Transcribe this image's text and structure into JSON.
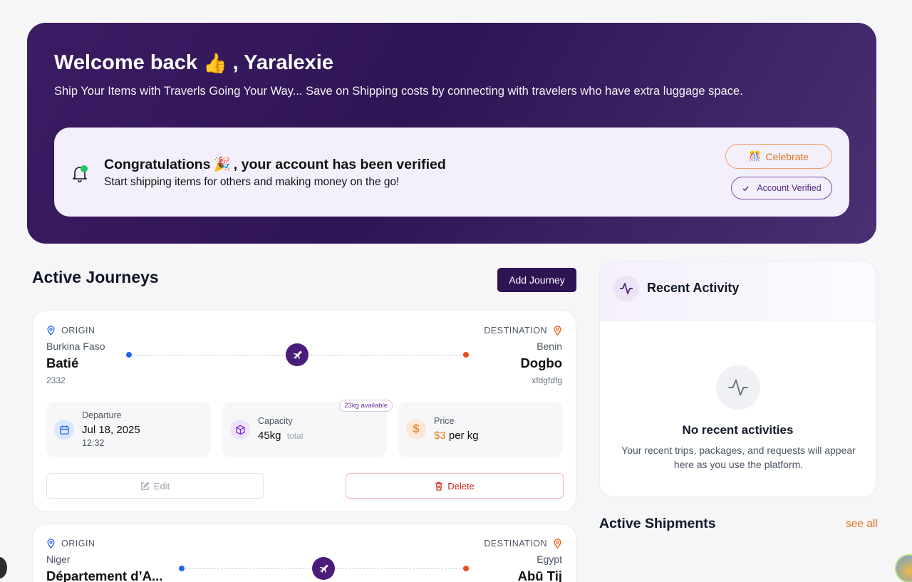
{
  "hero": {
    "title_prefix": "Welcome back",
    "title_emoji": "👍",
    "title_name": ", Yaralexie",
    "subtitle": "Ship Your Items with Traverls Going Your Way... Save on Shipping costs by connecting with travelers who have extra luggage space."
  },
  "verification": {
    "title_prefix": "Congratulations",
    "title_emoji": "🎉",
    "title_suffix": ", your account has been verified",
    "subtitle": "Start shipping items for others and making money on the go!",
    "celebrate_emoji": "🎊",
    "celebrate_label": "Celebrate",
    "verified_label": "Account Verified"
  },
  "journeys": {
    "title": "Active Journeys",
    "add_label": "Add Journey",
    "items": [
      {
        "origin_label": "ORIGIN",
        "origin_country": "Burkina Faso",
        "origin_city": "Batié",
        "origin_code": "2332",
        "destination_label": "DESTINATION",
        "destination_country": "Benin",
        "destination_city": "Dogbo",
        "destination_code": "xfdgfdfg",
        "departure_label": "Departure",
        "departure_date": "Jul 18, 2025",
        "departure_time": "12:32",
        "capacity_label": "Capacity",
        "capacity_value": "45kg",
        "capacity_unit": "total",
        "capacity_badge": "23kg available",
        "price_label": "Price",
        "price_value": "$3",
        "price_unit": "per kg",
        "edit_label": "Edit",
        "delete_label": "Delete"
      },
      {
        "origin_label": "ORIGIN",
        "origin_country": "Niger",
        "origin_city": "Département d’A...",
        "destination_label": "DESTINATION",
        "destination_country": "Egypt",
        "destination_city": "Abū Tij"
      }
    ]
  },
  "activity": {
    "title": "Recent Activity",
    "empty_title": "No recent activities",
    "empty_text": "Your recent trips, packages, and requests will appear here as you use the platform."
  },
  "shipments": {
    "title": "Active Shipments",
    "see_all": "see all"
  },
  "colors": {
    "brand": "#2e1452",
    "accent_orange": "#e0731b",
    "danger": "#d01f1f",
    "origin_dot": "#2563eb",
    "destination_dot": "#ea4e1b"
  }
}
